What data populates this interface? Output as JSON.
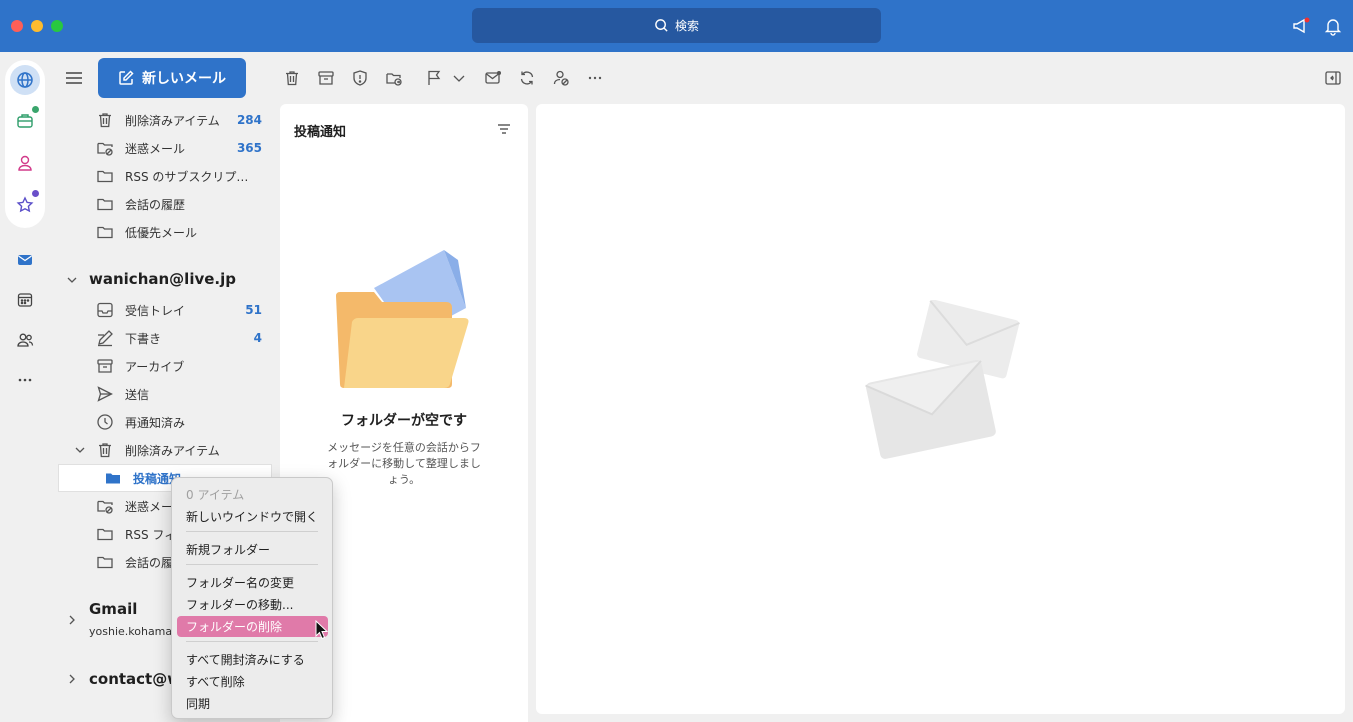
{
  "search": {
    "label": "検索"
  },
  "toolbar": {
    "new_mail_label": "新しいメール"
  },
  "folders_top": [
    {
      "label": "削除済みアイテム",
      "count": "284",
      "icon": "trash-icon"
    },
    {
      "label": "迷惑メール",
      "count": "365",
      "icon": "junk-folder-icon"
    },
    {
      "label": "RSS のサブスクリプシ…",
      "count": "",
      "icon": "folder-icon"
    },
    {
      "label": "会話の履歴",
      "count": "",
      "icon": "folder-icon"
    },
    {
      "label": "低優先メール",
      "count": "",
      "icon": "folder-icon"
    }
  ],
  "account1": {
    "name": "wanichan@live.jp",
    "folders": [
      {
        "label": "受信トレイ",
        "count": "51",
        "icon": "inbox-icon"
      },
      {
        "label": "下書き",
        "count": "4",
        "icon": "drafts-icon"
      },
      {
        "label": "アーカイブ",
        "count": "",
        "icon": "archive-icon"
      },
      {
        "label": "送信",
        "count": "",
        "icon": "send-icon"
      },
      {
        "label": "再通知済み",
        "count": "",
        "icon": "clock-icon"
      },
      {
        "label": "削除済みアイテム",
        "count": "",
        "icon": "trash-icon"
      },
      {
        "label": "投稿通知",
        "count": "",
        "icon": "folder-filled-icon"
      },
      {
        "label": "迷惑メール",
        "count": "",
        "icon": "junk-folder-icon"
      },
      {
        "label": "RSS フィ",
        "count": "",
        "icon": "folder-icon"
      },
      {
        "label": "会話の履歴",
        "count": "",
        "icon": "folder-icon"
      }
    ]
  },
  "account2": {
    "name": "Gmail",
    "email": "yoshie.kohama@"
  },
  "account3": {
    "name": "contact@wa"
  },
  "message_list": {
    "title": "投稿通知",
    "empty_title": "フォルダーが空です",
    "empty_body": "メッセージを任意の会話からフォルダーに移動して整理しましょう。"
  },
  "context_menu": {
    "items": [
      "0 アイテム",
      "新しいウインドウで開く",
      "新規フォルダー",
      "フォルダー名の変更",
      "フォルダーの移動...",
      "フォルダーの削除",
      "すべて開封済みにする",
      "すべて削除",
      "同期"
    ]
  },
  "colors": {
    "accent": "#2f73c9",
    "menu_highlight": "#e07aa9"
  }
}
